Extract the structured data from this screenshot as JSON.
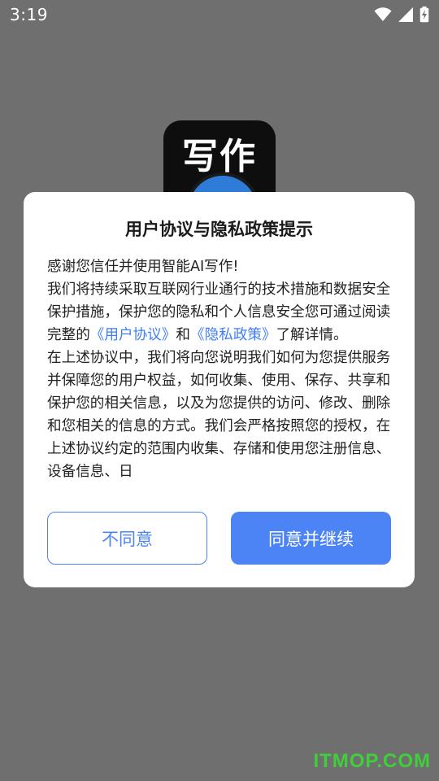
{
  "status_bar": {
    "time": "3:19",
    "icons": [
      "wifi-icon",
      "cell-signal-icon",
      "battery-charging-icon"
    ]
  },
  "app_logo": {
    "text": "写作",
    "bg_color": "#0e0e0e",
    "accent_color": "#2e7bd8"
  },
  "dialog": {
    "title": "用户协议与隐私政策提示",
    "intro": "感谢您信任并使用智能AI写作!",
    "paragraph1_a": "我们将持续采取互联网行业通行的技术措施和数据安全保护措施，保护您的隐私和个人信息安全您可通过阅读完整的",
    "link_user_agreement": "《用户协议》",
    "paragraph1_and": "和",
    "link_privacy_policy": "《隐私政策》",
    "paragraph1_end": "了解详情。",
    "paragraph2": "在上述协议中，我们将向您说明我们如何为您提供服务并保障您的用户权益，如何收集、使用、保存、共享和保护您的相关信息，以及为您提供的访问、修改、删除和您相关的信息的方式。我们会严格按照您的授权，在上述协议约定的范围内收集、存储和使用您注册信息、设备信息、日",
    "decline_label": "不同意",
    "accept_label": "同意并继续",
    "link_color": "#3f7df6",
    "primary_color": "#4d84f5"
  },
  "watermark": "ITMOP.COM"
}
